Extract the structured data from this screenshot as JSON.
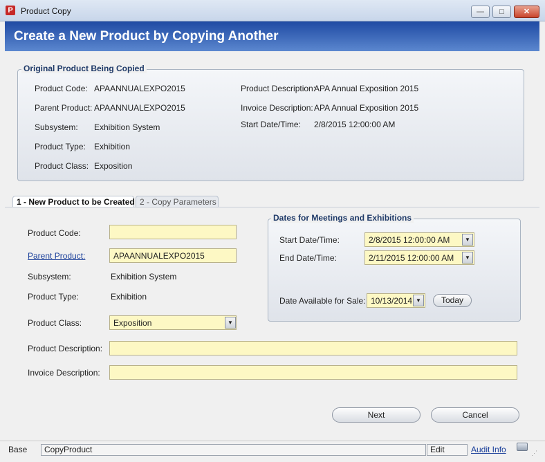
{
  "window": {
    "title": "Product Copy",
    "app_icon_glyph": "P",
    "minimize_glyph": "—",
    "maximize_glyph": "□",
    "close_glyph": "✕"
  },
  "header": {
    "title": "Create a New Product by Copying Another"
  },
  "original": {
    "legend": "Original Product Being Copied",
    "product_code_label": "Product Code:",
    "product_code": "APAANNUALEXPO2015",
    "parent_product_label": "Parent Product:",
    "parent_product": "APAANNUALEXPO2015",
    "subsystem_label": "Subsystem:",
    "subsystem": "Exhibition System",
    "product_type_label": "Product Type:",
    "product_type": "Exhibition",
    "product_class_label": "Product Class:",
    "product_class": "Exposition",
    "product_description_label": "Product Description:",
    "product_description": "APA Annual Exposition 2015",
    "invoice_description_label": "Invoice Description:",
    "invoice_description": "APA Annual Exposition 2015",
    "start_datetime_label": "Start Date/Time:",
    "start_datetime": "2/8/2015 12:00:00 AM"
  },
  "tabs": [
    {
      "label": "1 - New Product to be Created",
      "active": true
    },
    {
      "label": "2 - Copy Parameters",
      "active": false
    }
  ],
  "new_product": {
    "product_code_label": "Product Code:",
    "product_code_value": "",
    "parent_product_label": "Parent Product:",
    "parent_product_value": "APAANNUALEXPO2015",
    "subsystem_label": "Subsystem:",
    "subsystem": "Exhibition System",
    "product_type_label": "Product Type:",
    "product_type": "Exhibition",
    "product_class_label": "Product Class:",
    "product_class_value": "Exposition",
    "product_description_label": "Product Description:",
    "product_description_value": "",
    "invoice_description_label": "Invoice Description:",
    "invoice_description_value": ""
  },
  "dates": {
    "legend": "Dates for Meetings and Exhibitions",
    "start_label": "Start Date/Time:",
    "start_value": "2/8/2015 12:00:00 AM",
    "end_label": "End Date/Time:",
    "end_value": "2/11/2015 12:00:00 AM",
    "available_label": "Date Available for Sale:",
    "available_value": "10/13/2014",
    "today_label": "Today"
  },
  "buttons": {
    "next": "Next",
    "cancel": "Cancel"
  },
  "status_bar": {
    "base": "Base",
    "form_name": "CopyProduct",
    "mode": "Edit",
    "audit_info": "Audit Info"
  },
  "icons": {
    "app": "product-logo-icon",
    "dropdown": "chevron-down-icon",
    "resize": "resize-grip-icon"
  },
  "colors": {
    "header_gradient_top": "#1f4aa3",
    "header_gradient_bottom": "#5b87cf",
    "input_fill": "#fdf8c4",
    "legend_text": "#1f3a68",
    "link": "#1a3f9a"
  }
}
